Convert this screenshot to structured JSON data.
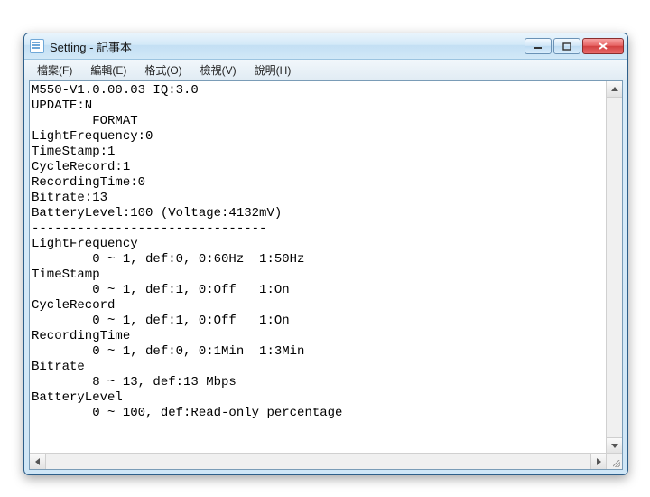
{
  "window": {
    "title": "Setting - 記事本"
  },
  "menu": {
    "file": "檔案(F)",
    "edit": "編輯(E)",
    "format": "格式(O)",
    "view": "檢視(V)",
    "help": "說明(H)"
  },
  "content": {
    "text": "M550-V1.0.00.03 IQ:3.0\nUPDATE:N\n        FORMAT\nLightFrequency:0\nTimeStamp:1\nCycleRecord:1\nRecordingTime:0\nBitrate:13\nBatteryLevel:100 (Voltage:4132mV)\n-------------------------------\nLightFrequency\n        0 ~ 1, def:0, 0:60Hz  1:50Hz\nTimeStamp\n        0 ~ 1, def:1, 0:Off   1:On\nCycleRecord\n        0 ~ 1, def:1, 0:Off   1:On\nRecordingTime\n        0 ~ 1, def:0, 0:1Min  1:3Min\nBitrate\n        8 ~ 13, def:13 Mbps\nBatteryLevel\n        0 ~ 100, def:Read-only percentage"
  }
}
